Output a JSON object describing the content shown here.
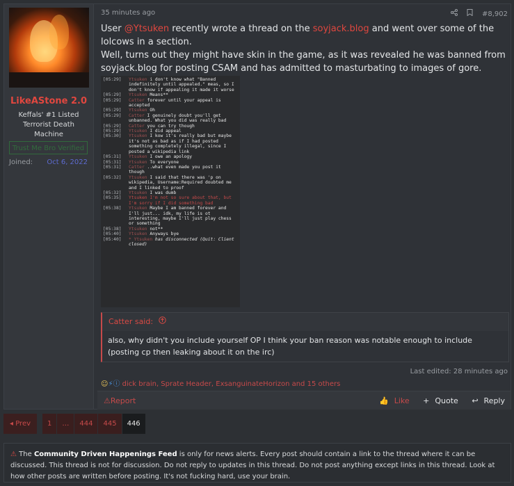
{
  "user": {
    "name": "LikeAStone 2.0",
    "title": "Keffals' #1 Listed Terrorist Death Machine",
    "banner": "Trust Me Bro Verified",
    "joined_label": "Joined:",
    "joined_value": "Oct 6, 2022"
  },
  "post": {
    "timestamp": "35 minutes ago",
    "number": "#8,902",
    "paragraph1_prefix": "User ",
    "mention": "@Ytsuken",
    "paragraph1_mid": " recently wrote a thread on the ",
    "link_soyjack": "soyjack.blog",
    "paragraph1_suffix": " and went over some of the lolcows in a section.",
    "paragraph2": "Well, turns out they might have skin in the game, as it was revealed he was banned from soyjack.blog for posting CSAM and has admitted to masturbating to images of gore.",
    "irc_log": [
      {
        "time": "[05:29]",
        "nick": "Ytsuken",
        "text": "i don't know what \"Banned indefinitely until appealed.\" meas, so I don't know if appealing it made it worse"
      },
      {
        "time": "[05:29]",
        "nick": "Ytsuken",
        "text": "Means**"
      },
      {
        "time": "[05:29]",
        "nick": "Catter",
        "text": "forever until your appeal is accepted"
      },
      {
        "time": "[05:29]",
        "nick": "Ytsuken",
        "text": "Oh"
      },
      {
        "time": "[05:29]",
        "nick": "Catter",
        "text": "I genuinely doubt you'll get unbanned. What you did was really bad"
      },
      {
        "time": "[05:29]",
        "nick": "Catter",
        "text": "you can try though"
      },
      {
        "time": "[05:29]",
        "nick": "Ytsuken",
        "text": "I did appeal"
      },
      {
        "time": "[05:30]",
        "nick": "Ytsuken",
        "text": "I kow it's really bad but maybe it's not as bad as if I had posted something completely illegal, since I posted a wikipedia link"
      },
      {
        "time": "[05:31]",
        "nick": "Ytsuken",
        "text": "I owe an apology"
      },
      {
        "time": "[05:31]",
        "nick": "Ytsuken",
        "text": "To everyone"
      },
      {
        "time": "[05:31]",
        "nick": "Catter",
        "text": "..what even made you post it though"
      },
      {
        "time": "[05:32]",
        "nick": "Ytsuken",
        "text": "I said that there was 'p on wikipedia, Username:Required doubted me and I linked to proof"
      },
      {
        "time": "[05:32]",
        "nick": "Ytsuken",
        "text": "I was dumb"
      },
      {
        "time": "[05:35]",
        "nick": "Ytsuken",
        "text": "I'm not so sure about that, but I'm sorry if I did something bad"
      },
      {
        "time": "[05:38]",
        "nick": "Ytsuken",
        "text": "Maybe I am banned forever and I'll just... idk, my life is ot interesting, maybe I'll just play chess or something"
      },
      {
        "time": "[05:38]",
        "nick": "Ytsuken",
        "text": "not**"
      },
      {
        "time": "[05:40]",
        "nick": "Ytsuken",
        "text": "Anyways bye"
      },
      {
        "time": "[05:40]",
        "nick": "* Ytsuken",
        "text": "has disconnected (Quit: Client closed)"
      }
    ],
    "quote_author": "Catter said:",
    "quote_text": "also, why didn't you include yourself OP I think your ban reason was notable enough to include (posting cp then leaking about it on the irc)",
    "last_edited": "Last edited: 28 minutes ago",
    "reactions_text": "dick brain, Sprate Header, ExsanguinateHorizon and 15 others",
    "report_label": "Report",
    "like_label": "Like",
    "quote_label": "Quote",
    "reply_label": "Reply"
  },
  "pagination": {
    "prev_label": "◂ Prev",
    "pages": [
      "1",
      "…",
      "444",
      "445",
      "446"
    ],
    "current": "446"
  },
  "notice": {
    "bold": "Community Driven Happenings Feed",
    "prefix": "The ",
    "text": " is only for news alerts. Every post should contain a link to the thread where it can be discussed. This thread is not for discussion. Do not reply to updates in this thread. Do not post anything except links in this thread. Look at how other posts are written before posting. It's not fucking hard, use your brain."
  },
  "colors": {
    "accent": "#c74a4a",
    "background": "#2d3034",
    "joined_date": "#5d6bd0",
    "banner": "#2f9e3c"
  }
}
